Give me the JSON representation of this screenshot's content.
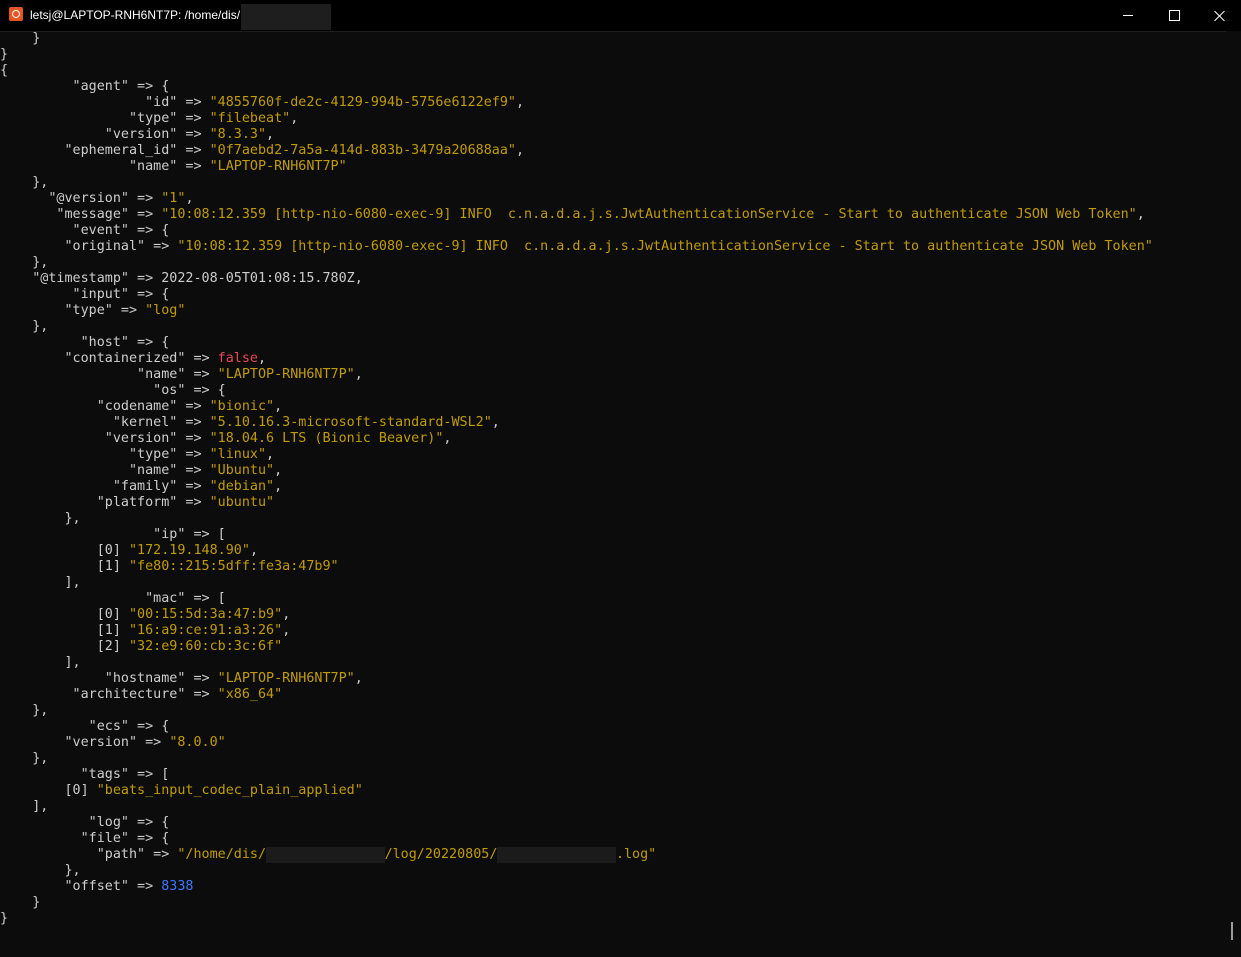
{
  "window": {
    "title": "letsj@LAPTOP-RNH6NT7P: /home/dis/",
    "icon": "ubuntu-terminal-icon",
    "buttons": {
      "minimize": "minimize-icon",
      "maximize": "maximize-icon",
      "close": "close-icon"
    }
  },
  "colors": {
    "background": "#0c0c0c",
    "text": "#cccccc",
    "string": "#c19c00",
    "boolean": "#e74856",
    "number": "#3b78ff"
  },
  "terminal": {
    "lines": [
      [
        [
          "k",
          "    }"
        ]
      ],
      [
        [
          "k",
          "}"
        ]
      ],
      [
        [
          "k",
          "{"
        ]
      ],
      [
        [
          "k",
          "         \"agent\" => {"
        ]
      ],
      [
        [
          "k",
          "                  \"id\" => "
        ],
        [
          "s",
          "\"4855760f-de2c-4129-994b-5756e6122ef9\""
        ],
        [
          "k",
          ","
        ]
      ],
      [
        [
          "k",
          "                \"type\" => "
        ],
        [
          "s",
          "\"filebeat\""
        ],
        [
          "k",
          ","
        ]
      ],
      [
        [
          "k",
          "             \"version\" => "
        ],
        [
          "s",
          "\"8.3.3\""
        ],
        [
          "k",
          ","
        ]
      ],
      [
        [
          "k",
          "        \"ephemeral_id\" => "
        ],
        [
          "s",
          "\"0f7aebd2-7a5a-414d-883b-3479a20688aa\""
        ],
        [
          "k",
          ","
        ]
      ],
      [
        [
          "k",
          "                \"name\" => "
        ],
        [
          "s",
          "\"LAPTOP-RNH6NT7P\""
        ]
      ],
      [
        [
          "k",
          "    },"
        ]
      ],
      [
        [
          "k",
          "      \"@version\" => "
        ],
        [
          "s",
          "\"1\""
        ],
        [
          "k",
          ","
        ]
      ],
      [
        [
          "k",
          "       \"message\" => "
        ],
        [
          "s",
          "\"10:08:12.359 [http-nio-6080-exec-9] INFO  c.n.a.d.a.j.s.JwtAuthenticationService - Start to authenticate JSON Web Token\""
        ],
        [
          "k",
          ","
        ]
      ],
      [
        [
          "k",
          "         \"event\" => {"
        ]
      ],
      [
        [
          "k",
          "        \"original\" => "
        ],
        [
          "s",
          "\"10:08:12.359 [http-nio-6080-exec-9] INFO  c.n.a.d.a.j.s.JwtAuthenticationService - Start to authenticate JSON Web Token\""
        ]
      ],
      [
        [
          "k",
          "    },"
        ]
      ],
      [
        [
          "k",
          "    \"@timestamp\" => 2022-08-05T01:08:15.780Z,"
        ]
      ],
      [
        [
          "k",
          "         \"input\" => {"
        ]
      ],
      [
        [
          "k",
          "        \"type\" => "
        ],
        [
          "s",
          "\"log\""
        ]
      ],
      [
        [
          "k",
          "    },"
        ]
      ],
      [
        [
          "k",
          "          \"host\" => {"
        ]
      ],
      [
        [
          "k",
          "        \"containerized\" => "
        ],
        [
          "b",
          "false"
        ],
        [
          "k",
          ","
        ]
      ],
      [
        [
          "k",
          "                 \"name\" => "
        ],
        [
          "s",
          "\"LAPTOP-RNH6NT7P\""
        ],
        [
          "k",
          ","
        ]
      ],
      [
        [
          "k",
          "                   \"os\" => {"
        ]
      ],
      [
        [
          "k",
          "            \"codename\" => "
        ],
        [
          "s",
          "\"bionic\""
        ],
        [
          "k",
          ","
        ]
      ],
      [
        [
          "k",
          "              \"kernel\" => "
        ],
        [
          "s",
          "\"5.10.16.3-microsoft-standard-WSL2\""
        ],
        [
          "k",
          ","
        ]
      ],
      [
        [
          "k",
          "             \"version\" => "
        ],
        [
          "s",
          "\"18.04.6 LTS (Bionic Beaver)\""
        ],
        [
          "k",
          ","
        ]
      ],
      [
        [
          "k",
          "                \"type\" => "
        ],
        [
          "s",
          "\"linux\""
        ],
        [
          "k",
          ","
        ]
      ],
      [
        [
          "k",
          "                \"name\" => "
        ],
        [
          "s",
          "\"Ubuntu\""
        ],
        [
          "k",
          ","
        ]
      ],
      [
        [
          "k",
          "              \"family\" => "
        ],
        [
          "s",
          "\"debian\""
        ],
        [
          "k",
          ","
        ]
      ],
      [
        [
          "k",
          "            \"platform\" => "
        ],
        [
          "s",
          "\"ubuntu\""
        ]
      ],
      [
        [
          "k",
          "        },"
        ]
      ],
      [
        [
          "k",
          "                   \"ip\" => ["
        ]
      ],
      [
        [
          "k",
          "            [0] "
        ],
        [
          "s",
          "\"172.19.148.90\""
        ],
        [
          "k",
          ","
        ]
      ],
      [
        [
          "k",
          "            [1] "
        ],
        [
          "s",
          "\"fe80::215:5dff:fe3a:47b9\""
        ]
      ],
      [
        [
          "k",
          "        ],"
        ]
      ],
      [
        [
          "k",
          "                  \"mac\" => ["
        ]
      ],
      [
        [
          "k",
          "            [0] "
        ],
        [
          "s",
          "\"00:15:5d:3a:47:b9\""
        ],
        [
          "k",
          ","
        ]
      ],
      [
        [
          "k",
          "            [1] "
        ],
        [
          "s",
          "\"16:a9:ce:91:a3:26\""
        ],
        [
          "k",
          ","
        ]
      ],
      [
        [
          "k",
          "            [2] "
        ],
        [
          "s",
          "\"32:e9:60:cb:3c:6f\""
        ]
      ],
      [
        [
          "k",
          "        ],"
        ]
      ],
      [
        [
          "k",
          "             \"hostname\" => "
        ],
        [
          "s",
          "\"LAPTOP-RNH6NT7P\""
        ],
        [
          "k",
          ","
        ]
      ],
      [
        [
          "k",
          "         \"architecture\" => "
        ],
        [
          "s",
          "\"x86_64\""
        ]
      ],
      [
        [
          "k",
          "    },"
        ]
      ],
      [
        [
          "k",
          "           \"ecs\" => {"
        ]
      ],
      [
        [
          "k",
          "        \"version\" => "
        ],
        [
          "s",
          "\"8.0.0\""
        ]
      ],
      [
        [
          "k",
          "    },"
        ]
      ],
      [
        [
          "k",
          "          \"tags\" => ["
        ]
      ],
      [
        [
          "k",
          "        [0] "
        ],
        [
          "s",
          "\"beats_input_codec_plain_applied\""
        ]
      ],
      [
        [
          "k",
          "    ],"
        ]
      ],
      [
        [
          "k",
          "           \"log\" => {"
        ]
      ],
      [
        [
          "k",
          "          \"file\" => {"
        ]
      ],
      [
        [
          "k",
          "            \"path\" => "
        ],
        [
          "s",
          "\"/home/dis/"
        ],
        [
          "r",
          "15"
        ],
        [
          "s",
          "/log/20220805/"
        ],
        [
          "r",
          "15"
        ],
        [
          "s",
          ".log\""
        ]
      ],
      [
        [
          "k",
          "        },"
        ]
      ],
      [
        [
          "k",
          "        \"offset\" => "
        ],
        [
          "n",
          "8338"
        ]
      ],
      [
        [
          "k",
          "    }"
        ]
      ],
      [
        [
          "k",
          "}"
        ]
      ],
      [
        [
          "k",
          ""
        ]
      ],
      [
        [
          "k",
          ""
        ]
      ]
    ]
  }
}
